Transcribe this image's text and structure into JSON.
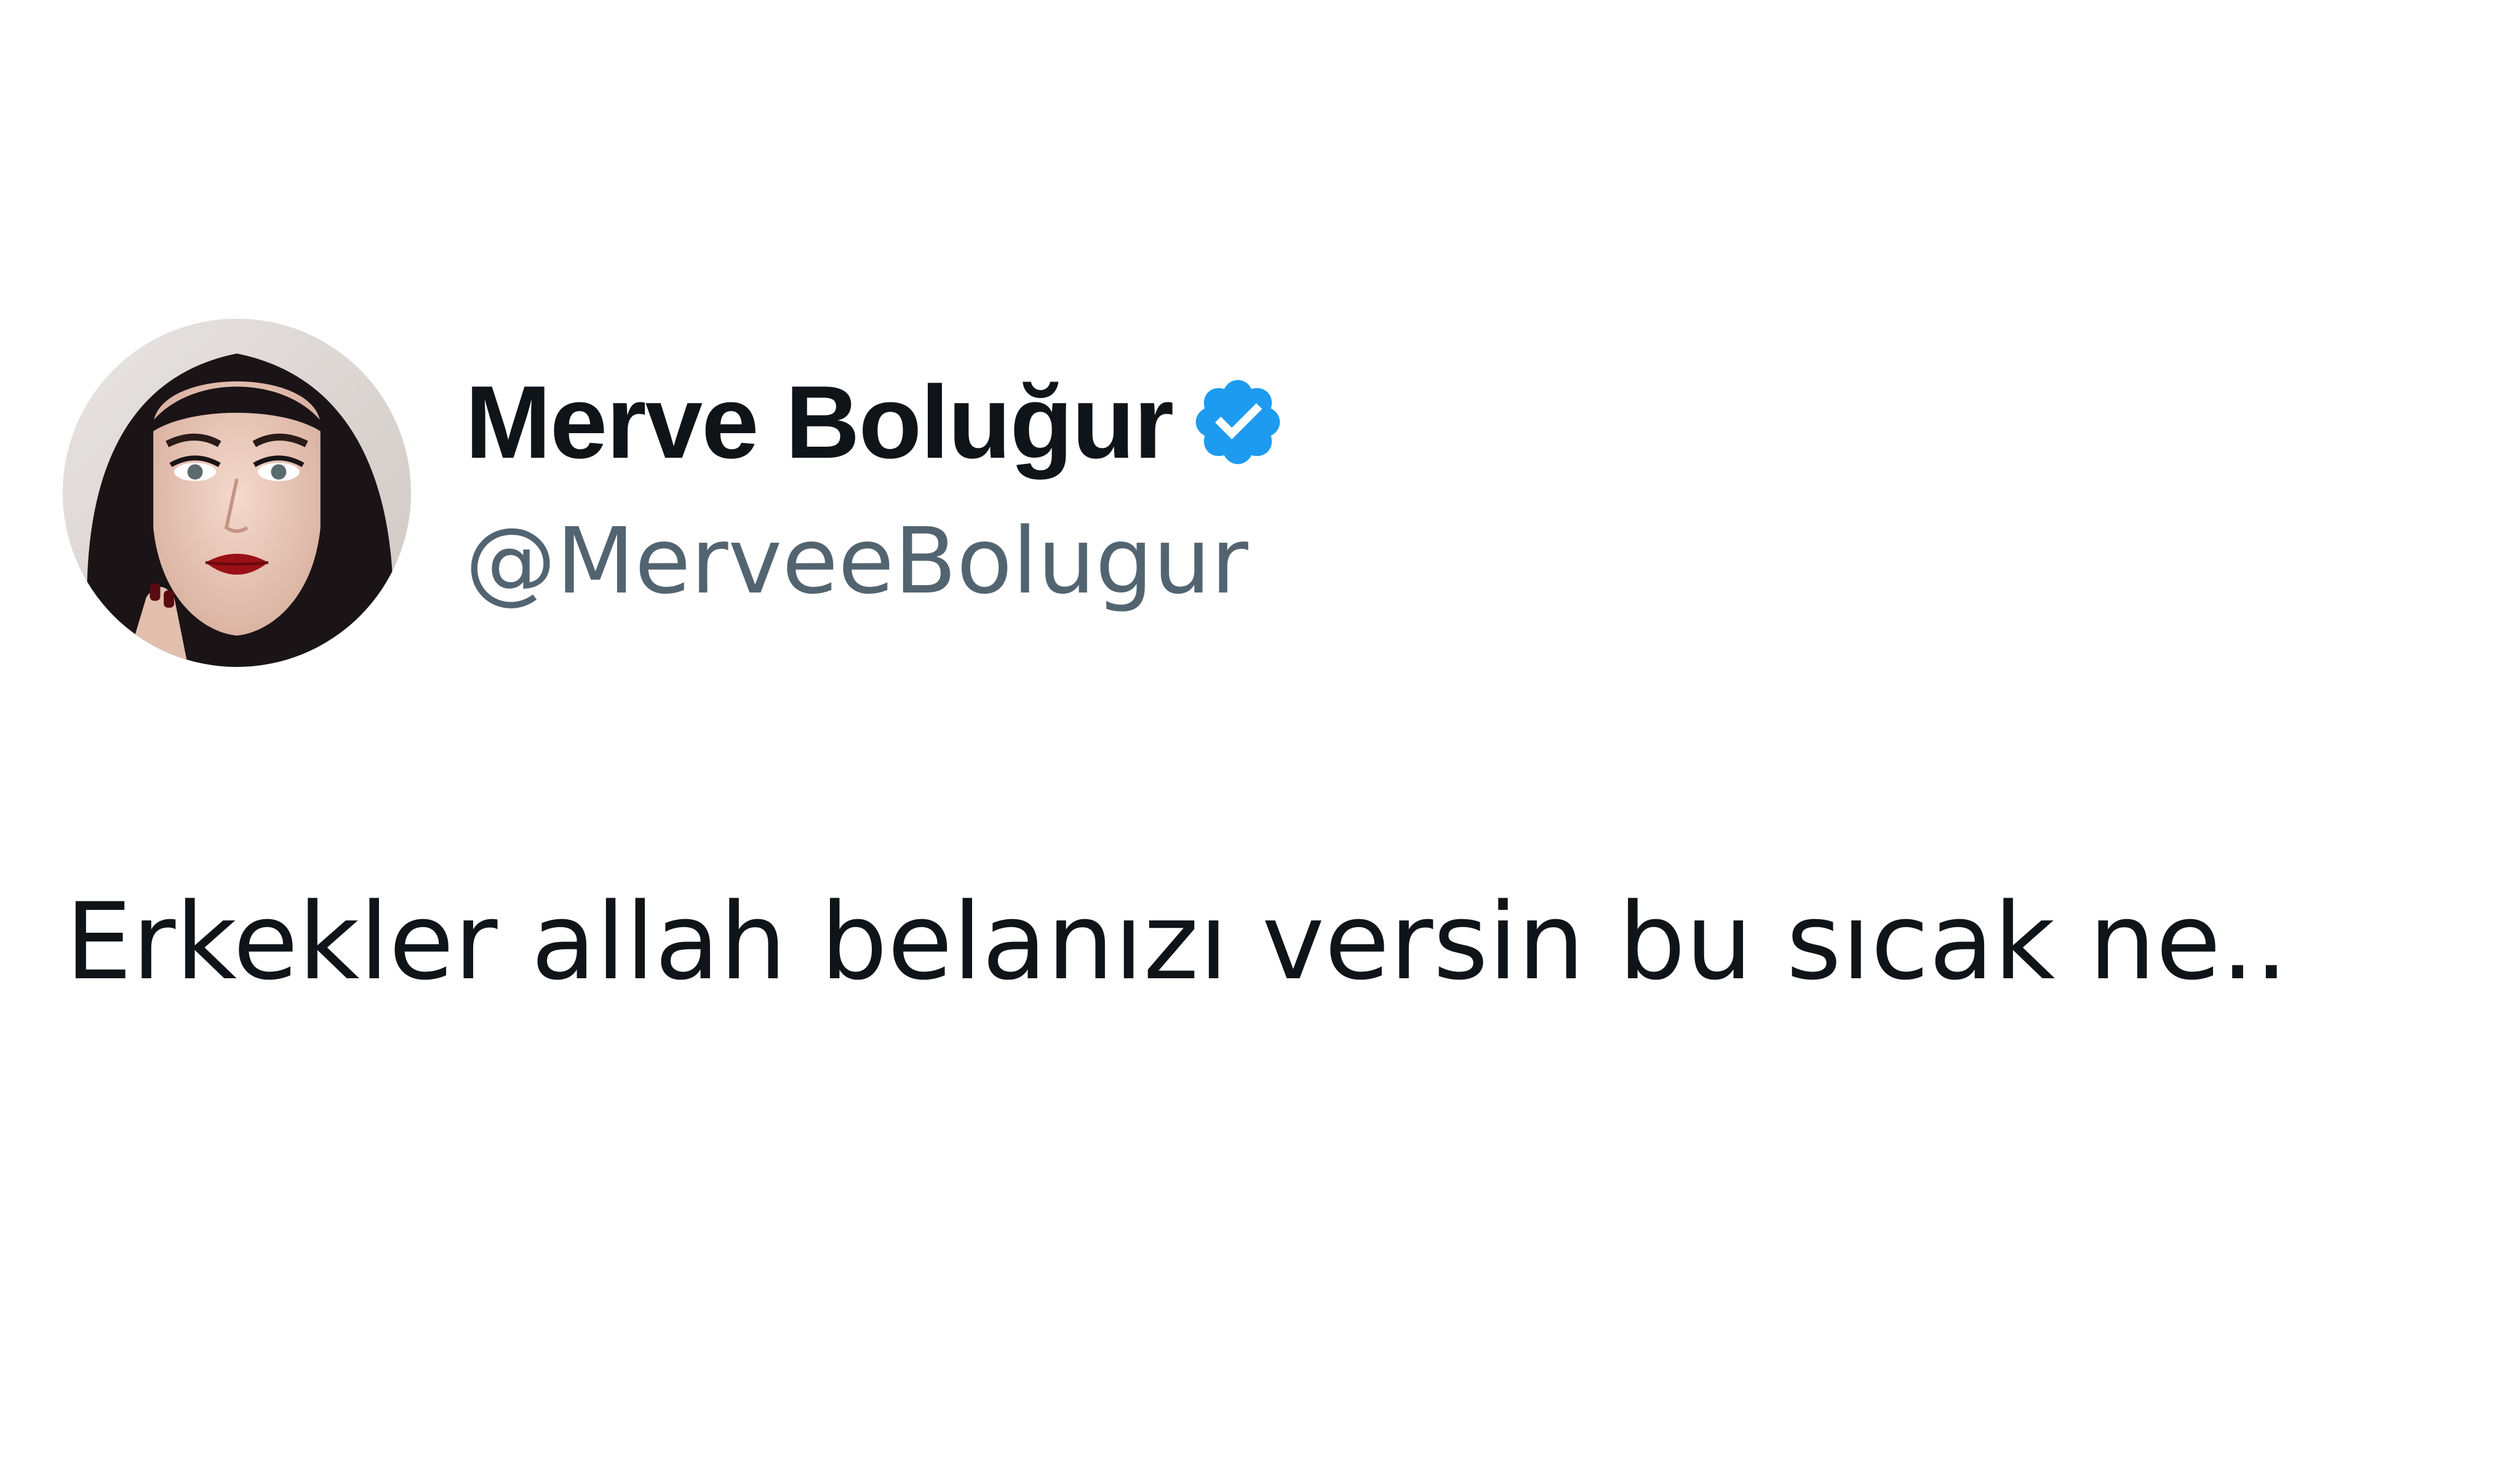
{
  "tweet": {
    "author": {
      "display_name": "Merve Boluğur",
      "handle": "@MerveeBolugur",
      "verified": true,
      "avatar": "profile-photo"
    },
    "text": "Erkekler allah belanızı versin bu sıcak ne.."
  },
  "colors": {
    "background": "#ffffff",
    "text_primary": "#0f1419",
    "text_secondary": "#536471",
    "verified_badge": "#1d9bf0"
  },
  "icons": {
    "verified": "verified-badge-icon"
  }
}
